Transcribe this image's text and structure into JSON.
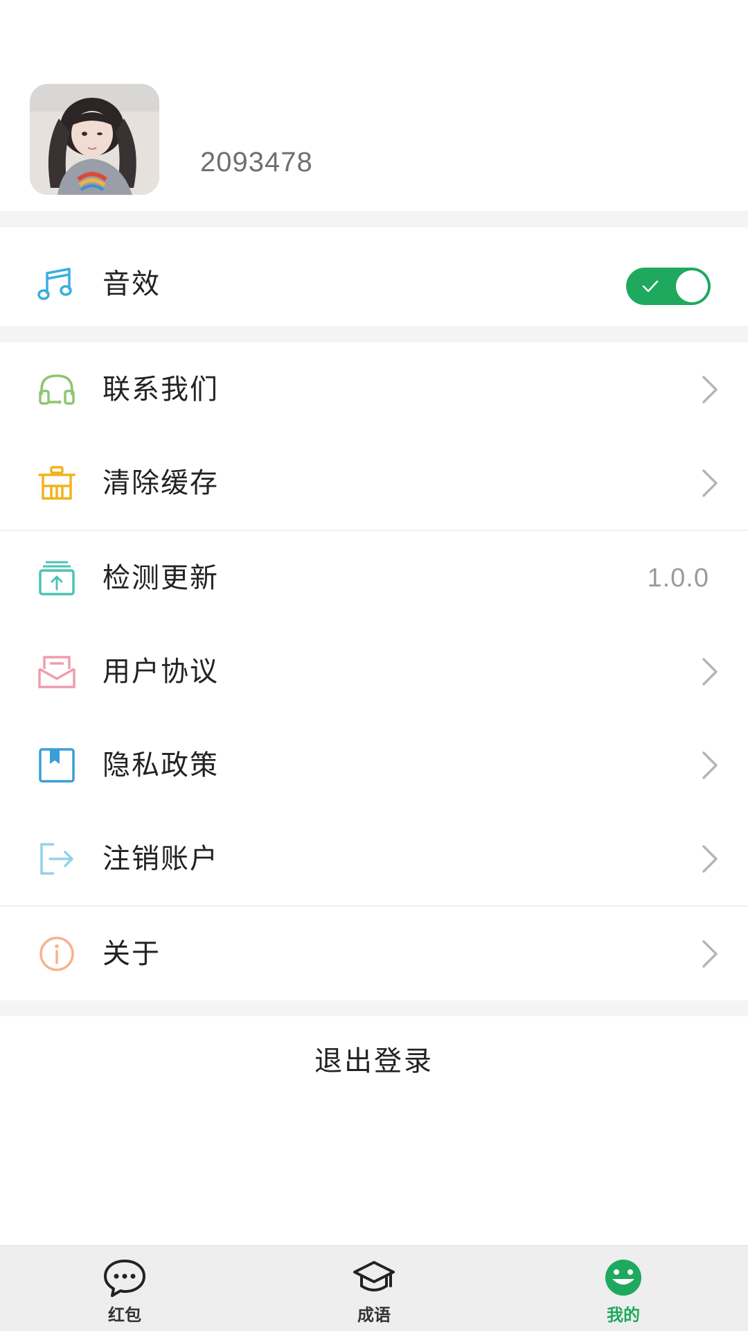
{
  "profile": {
    "user_id": "2093478"
  },
  "settings": {
    "sound": {
      "label": "音效",
      "enabled": true,
      "icon": "music-note-icon"
    },
    "items": [
      {
        "label": "联系我们",
        "icon": "headset-icon"
      },
      {
        "label": "清除缓存",
        "icon": "trash-icon"
      },
      {
        "label": "检测更新",
        "icon": "upload-box-icon",
        "value": "1.0.0"
      },
      {
        "label": "用户协议",
        "icon": "envelope-icon"
      },
      {
        "label": "隐私政策",
        "icon": "bookmark-icon"
      },
      {
        "label": "注销账户",
        "icon": "exit-icon"
      },
      {
        "label": "关于",
        "icon": "info-icon"
      }
    ]
  },
  "logout_label": "退出登录",
  "tabbar": {
    "tabs": [
      {
        "label": "红包",
        "icon": "chat-bubble-icon",
        "active": false
      },
      {
        "label": "成语",
        "icon": "graduation-cap-icon",
        "active": false
      },
      {
        "label": "我的",
        "icon": "smiley-icon",
        "active": true
      }
    ]
  },
  "colors": {
    "accent": "#1ea95f",
    "background": "#ffffff",
    "separator": "#f4f4f4",
    "chevron": "#b5b5b5"
  }
}
